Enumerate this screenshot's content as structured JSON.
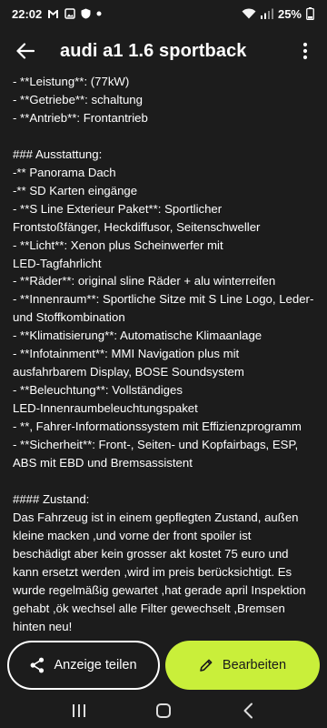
{
  "status_bar": {
    "time": "22:02",
    "battery": "25%",
    "left_icons": [
      "gmail-icon",
      "image-icon",
      "shield-icon",
      "dot-icon"
    ],
    "right_icons": [
      "wifi-icon",
      "signal-icon",
      "battery-icon"
    ]
  },
  "header": {
    "title": "audi a1 1.6 sportback",
    "back_icon": "arrow-left-icon",
    "menu_icon": "more-vertical-icon"
  },
  "content": {
    "lines": [
      "- **Leistung**: (77kW)",
      "- **Getriebe**: schaltung",
      "- **Antrieb**: Frontantrieb",
      "",
      "### Ausstattung:",
      "-** Panorama Dach",
      "-** SD Karten eingänge",
      "- **S Line Exterieur Paket**: Sportlicher",
      "Frontstoßfänger, Heckdiffusor, Seitenschweller",
      "- **Licht**: Xenon plus Scheinwerfer mit",
      "LED-Tagfahrlicht",
      "- **Räder**: original sline Räder + alu winterreifen",
      "- **Innenraum**: Sportliche Sitze mit S Line Logo, Leder-",
      "und Stoffkombination",
      "- **Klimatisierung**: Automatische Klimaanlage",
      "- **Infotainment**: MMI Navigation plus mit",
      "ausfahrbarem Display, BOSE Soundsystem",
      "- **Beleuchtung**: Vollständiges",
      "LED-Innenraumbeleuchtungspaket",
      "- **, Fahrer-Informationssystem mit Effizienzprogramm",
      "- **Sicherheit**: Front-, Seiten- und Kopfairbags, ESP,",
      "ABS mit EBD und Bremsassistent",
      "",
      "#### Zustand:",
      "Das Fahrzeug ist in einem gepflegten Zustand, außen",
      "kleine macken ,und vorne der front spoiler ist",
      "beschädigt aber kein grosser akt kostet 75 euro und",
      "kann ersetzt werden ,wird im preis berücksichtigt. Es",
      "wurde regelmäßig gewartet ,hat gerade april Inspektion",
      "gehabt ,ök wechsel alle Filter gewechselt ,Bremsen",
      "hinten neu!"
    ]
  },
  "actions": {
    "share_label": "Anzeige teilen",
    "share_icon": "share-icon",
    "edit_label": "Bearbeiten",
    "edit_icon": "pencil-icon"
  },
  "nav": {
    "icons": [
      "recents-icon",
      "home-icon",
      "back-icon"
    ]
  },
  "colors": {
    "background": "#1c1c1c",
    "accent": "#c9ef3a",
    "text": "#ffffff"
  }
}
